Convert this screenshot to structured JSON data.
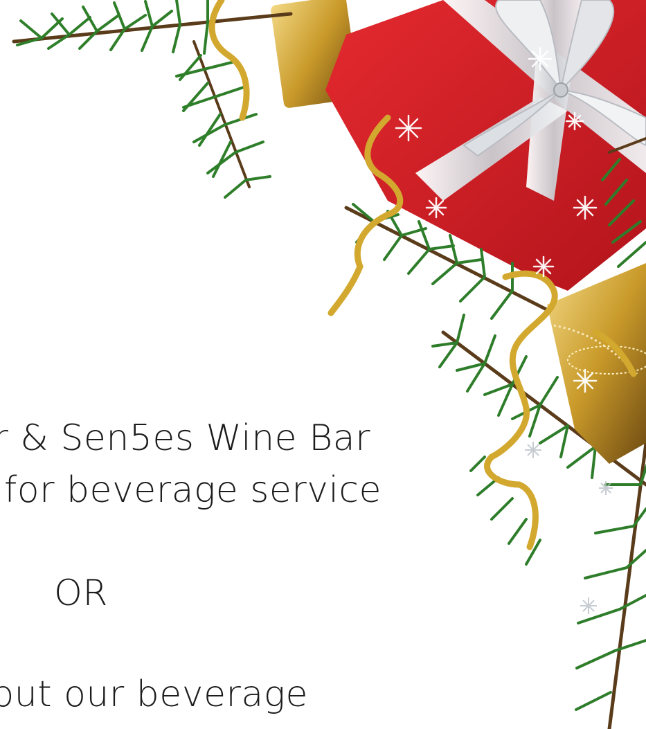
{
  "text": {
    "line1": "r & Sen5es Wine Bar",
    "line2": "for beverage service",
    "line3": "OR",
    "line4": "out our beverage"
  },
  "colors": {
    "background": "#ffffff",
    "text": "#1c1c1c",
    "gift_red": "#d21f26",
    "ribbon_white": "#e9eaec",
    "gold": "#c99a2a",
    "pine": "#2e7d2a"
  },
  "decoration": {
    "icons": [
      "pine-branch-icon",
      "red-gift-box-icon",
      "gold-gift-box-icon",
      "gold-curl-ribbon-icon",
      "snowflake-icon"
    ]
  }
}
